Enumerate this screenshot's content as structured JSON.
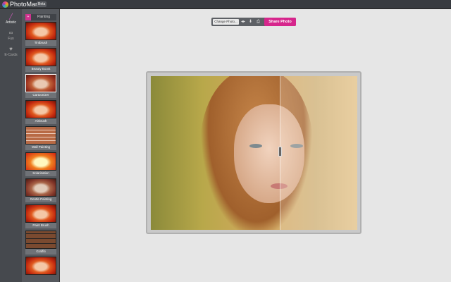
{
  "app": {
    "title": "PhotoMania",
    "badge": "Beta"
  },
  "nav": [
    {
      "label": "Artistic",
      "icon": "brush-icon",
      "active": true
    },
    {
      "label": "Fun",
      "icon": "glasses-icon"
    },
    {
      "label": "E-Cards",
      "icon": "heart-icon"
    }
  ],
  "category": {
    "button": "+",
    "label": "Painting"
  },
  "effects": [
    "Tintbrush",
    "Beauty Boost",
    "Cartoonizer",
    "Airbrush",
    "Wall Painting",
    "Solarization",
    "Gentle Painting",
    "Paint Brush",
    "Graffiti",
    ""
  ],
  "toolbar": {
    "change_photo": "Change Photo...",
    "share": "Share Photo",
    "compare_icon": "◂▸",
    "download_icon": "⬇",
    "print_icon": "⎙"
  }
}
